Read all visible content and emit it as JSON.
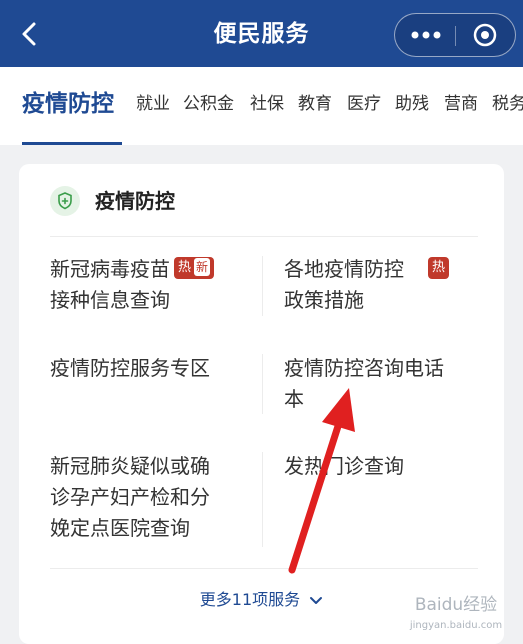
{
  "header": {
    "title": "便民服务",
    "back_icon": "chevron-left-icon",
    "menu_icon": "more-dots-icon",
    "close_icon": "target-circle-icon"
  },
  "tabs": [
    {
      "label": "疫情防控",
      "active": true
    },
    {
      "label": "就业"
    },
    {
      "label": "公积金"
    },
    {
      "label": "社保"
    },
    {
      "label": "教育"
    },
    {
      "label": "医疗"
    },
    {
      "label": "助残"
    },
    {
      "label": "营商"
    },
    {
      "label": "税务"
    }
  ],
  "card": {
    "title": "疫情防控",
    "icon": "shield-icon",
    "items": [
      {
        "line1": "新冠病毒疫苗",
        "line2": "接种信息查询",
        "badge": "热",
        "badge_new": "新"
      },
      {
        "line1": "各地疫情防控",
        "line2": "政策措施",
        "badge": "热"
      },
      {
        "line1": "疫情防控服务专区"
      },
      {
        "line1": "疫情防控咨询电话",
        "line2": "本"
      },
      {
        "line1": "新冠肺炎疑似或确",
        "line2": "诊孕产妇产检和分",
        "line3": "娩定点医院查询"
      },
      {
        "line1": "发热门诊查询"
      }
    ],
    "more_label": "更多11项服务"
  },
  "colors": {
    "primary": "#1f4a93",
    "hot_badge": "#c0392b",
    "arrow": "#e02020"
  },
  "watermark": {
    "text": "Baidu经验",
    "sub": "jingyan.baidu.com"
  }
}
